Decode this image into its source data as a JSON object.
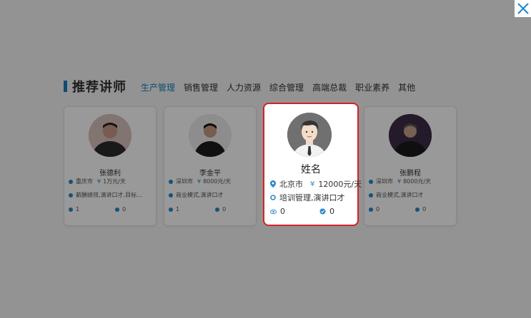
{
  "section": {
    "title": "推荐讲师"
  },
  "tabs": [
    "生产管理",
    "销售管理",
    "人力资源",
    "综合管理",
    "高端总裁",
    "职业素养",
    "其他"
  ],
  "background_cards": [
    {
      "name": "张德利",
      "city": "重庆市",
      "price": "1万元/天",
      "topic": "薪酬绩效,演讲口才,目标...",
      "views": "1",
      "likes": "0"
    },
    {
      "name": "李金平",
      "city": "深圳市",
      "price": "8000元/天",
      "topic": "商业模式,演讲口才",
      "views": "1",
      "likes": "0"
    },
    {
      "name": "张鹏程",
      "city": "深圳市",
      "price": "8000元/天",
      "topic": "商业模式,演讲口才",
      "views": "0",
      "likes": "0"
    }
  ],
  "highlight_card": {
    "name": "姓名",
    "city": "北京市",
    "yen": "¥",
    "price": "12000元/天",
    "topic": "培训管理,演讲口才",
    "views": "0",
    "likes": "0"
  },
  "colors": {
    "accent": "#1a7fc0",
    "highlight_border": "#d81f25",
    "icon": "#2a88c8"
  },
  "icons": {
    "close": "close-icon",
    "location": "location-pin-icon",
    "topic": "topic-circle-icon",
    "views": "eye-icon",
    "likes": "like-icon"
  }
}
